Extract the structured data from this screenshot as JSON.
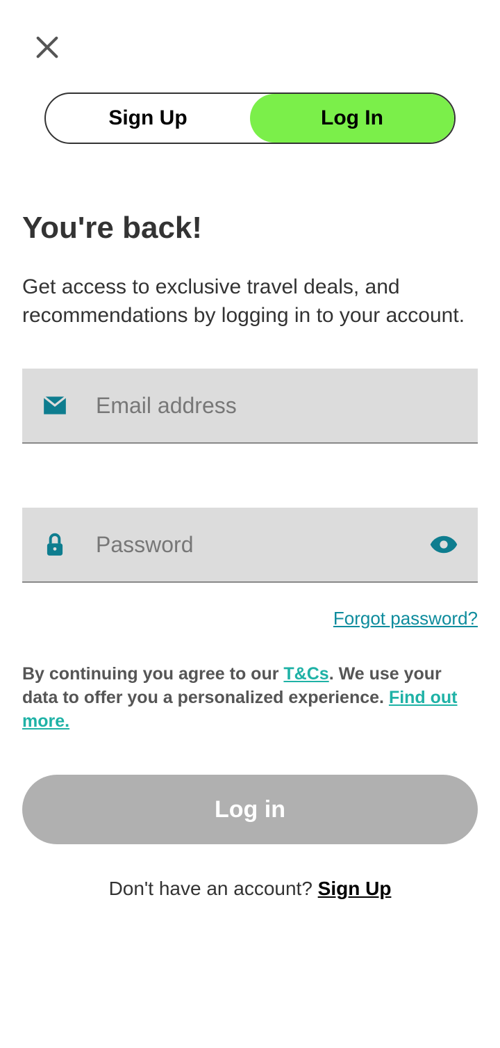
{
  "tabs": {
    "signup": "Sign Up",
    "login": "Log In"
  },
  "heading": "You're back!",
  "subtitle": "Get access to exclusive travel deals, and recommendations by logging in to your account.",
  "fields": {
    "email_placeholder": "Email address",
    "password_placeholder": "Password"
  },
  "forgot_password": "Forgot password?",
  "legal": {
    "prefix": "By continuing you agree to our ",
    "tcs": "T&Cs",
    "mid": ". We use your data to offer you a personalized experience. ",
    "more": "Find out more."
  },
  "submit": "Log in",
  "footer": {
    "prompt": "Don't have an account? ",
    "link": "Sign Up"
  }
}
